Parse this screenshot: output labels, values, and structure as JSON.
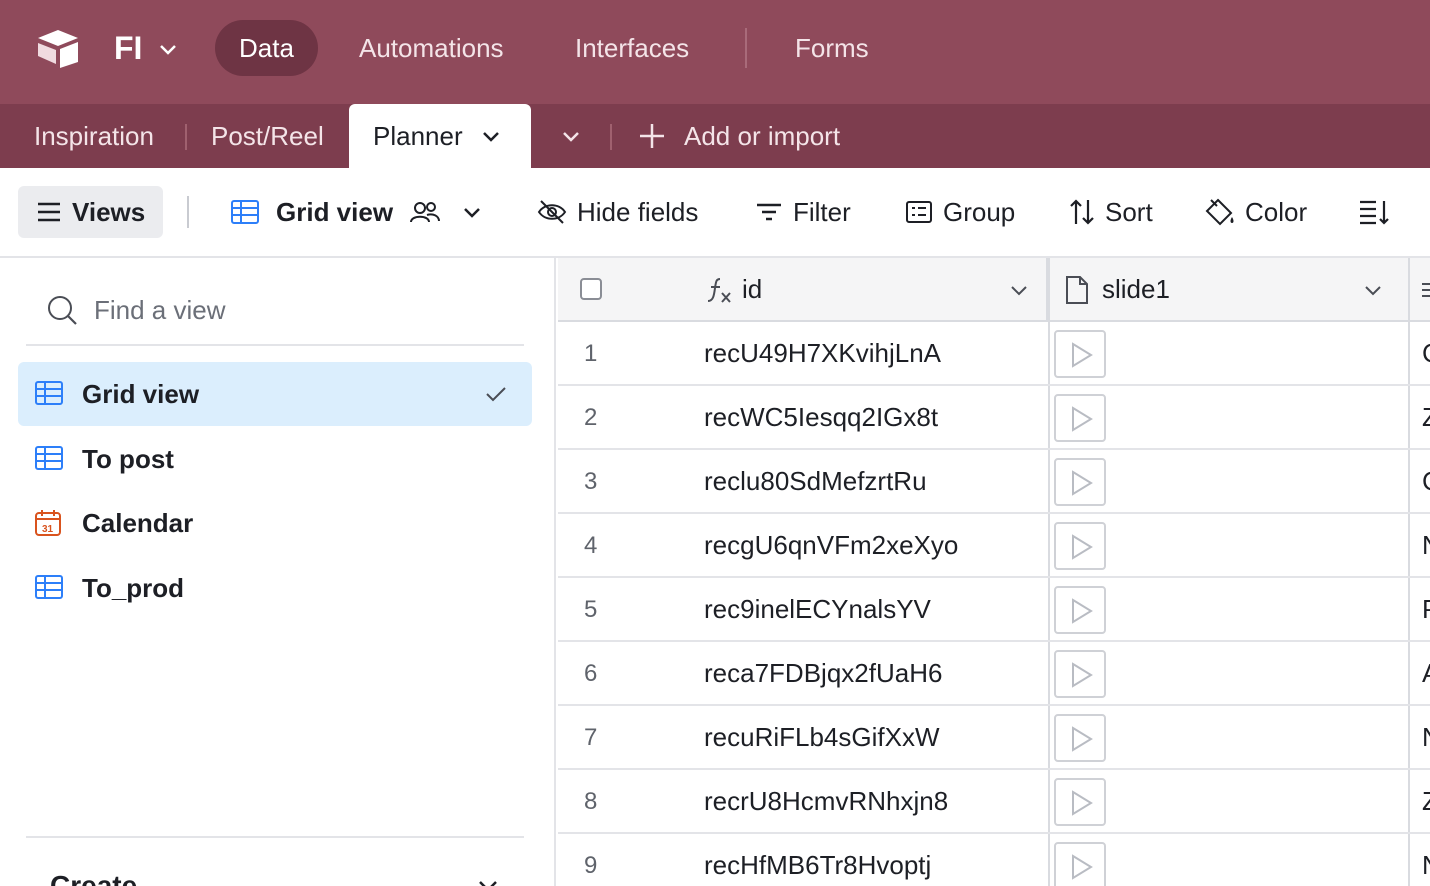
{
  "topbar": {
    "base_name": "FI",
    "nav": [
      "Data",
      "Automations",
      "Interfaces",
      "Forms"
    ],
    "active_nav": "Data",
    "color": "#8f4a5b"
  },
  "tabs": {
    "items": [
      "Inspiration",
      "Post/Reel",
      "Planner"
    ],
    "active": "Planner",
    "add_label": "Add or import",
    "color": "#7d3d4e"
  },
  "toolbar": {
    "views_label": "Views",
    "view_name": "Grid view",
    "hide_fields": "Hide fields",
    "filter": "Filter",
    "group": "Group",
    "sort": "Sort",
    "color": "Color"
  },
  "sidebar": {
    "search_placeholder": "Find a view",
    "views": [
      {
        "label": "Grid view",
        "icon": "grid-icon",
        "selected": true
      },
      {
        "label": "To post",
        "icon": "grid-icon",
        "selected": false
      },
      {
        "label": "Calendar",
        "icon": "calendar-icon",
        "selected": false
      },
      {
        "label": "To_prod",
        "icon": "grid-icon",
        "selected": false
      }
    ],
    "create_label": "Create"
  },
  "grid": {
    "columns": [
      {
        "name": "id",
        "icon": "formula-icon"
      },
      {
        "name": "slide1",
        "icon": "attachment-icon"
      }
    ],
    "rows": [
      {
        "num": "1",
        "id": "recU49H7XKvihjLnA",
        "next": "C"
      },
      {
        "num": "2",
        "id": "recWC5Iesqq2IGx8t",
        "next": "Z"
      },
      {
        "num": "3",
        "id": "reclu80SdMefzrtRu",
        "next": "C"
      },
      {
        "num": "4",
        "id": "recgU6qnVFm2xeXyo",
        "next": "N"
      },
      {
        "num": "5",
        "id": "rec9inelECYnalsYV",
        "next": "P"
      },
      {
        "num": "6",
        "id": "reca7FDBjqx2fUaH6",
        "next": "A"
      },
      {
        "num": "7",
        "id": "recuRiFLb4sGifXxW",
        "next": "N"
      },
      {
        "num": "8",
        "id": "recrU8HcmvRNhxjn8",
        "next": "Z"
      },
      {
        "num": "9",
        "id": "recHfMB6Tr8Hvoptj",
        "next": "N"
      }
    ]
  }
}
